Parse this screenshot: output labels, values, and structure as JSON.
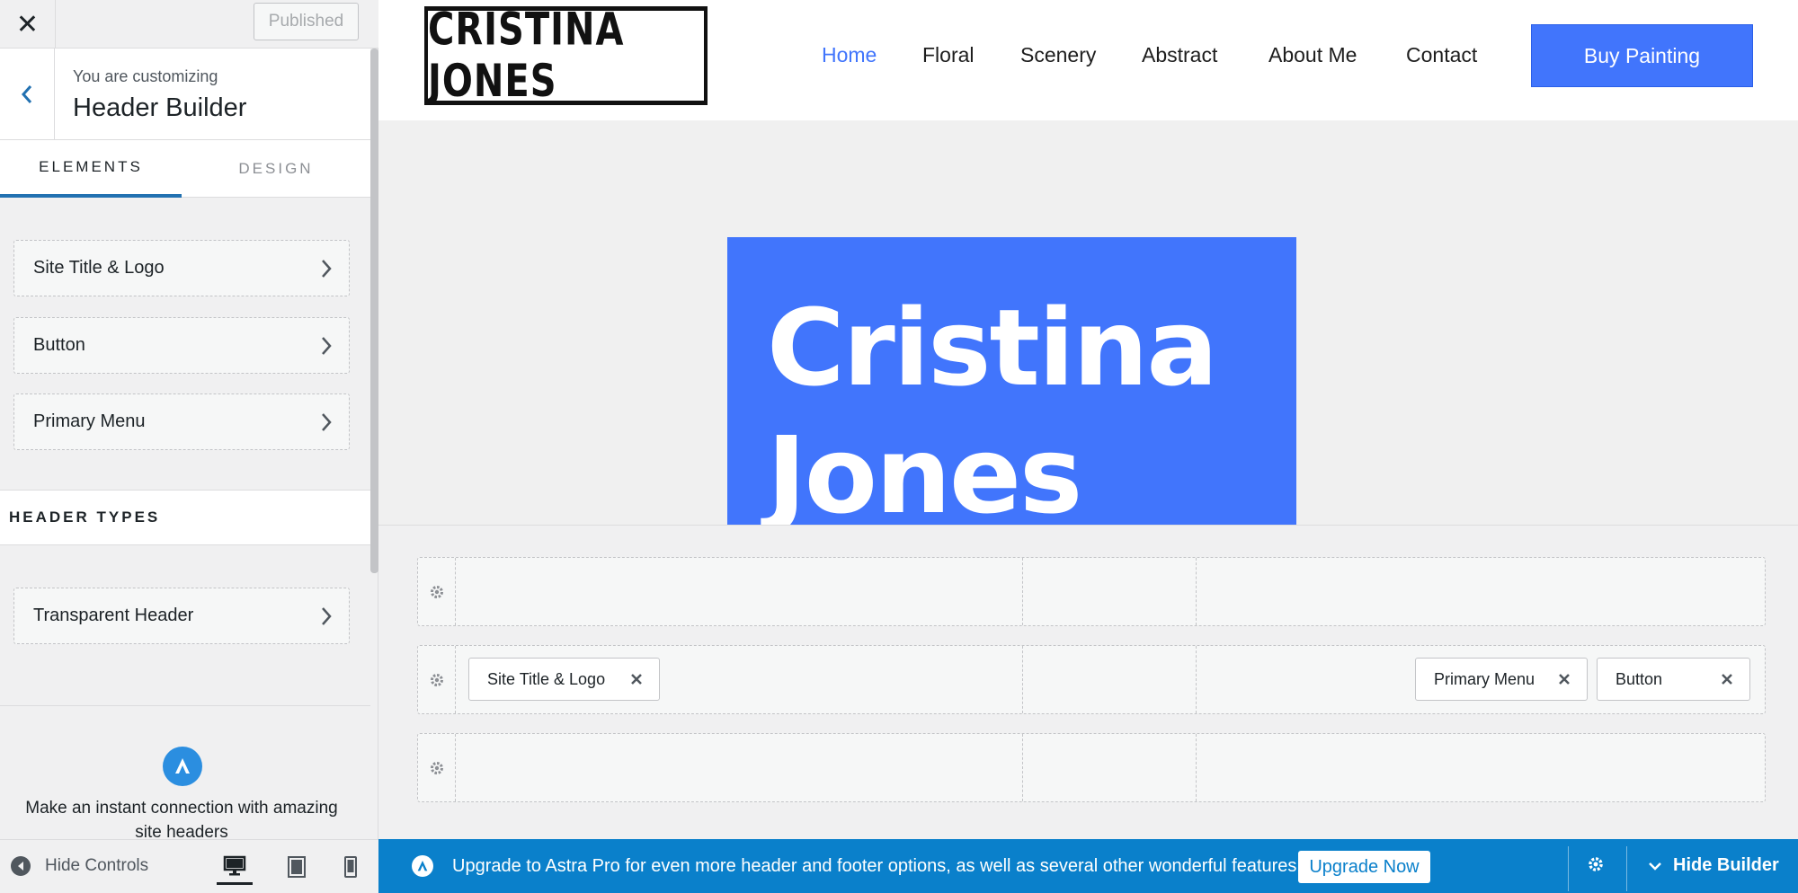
{
  "colors": {
    "accent": "#4175fc",
    "wp_blue": "#2271b1",
    "astra_bar": "#0a80cb"
  },
  "sidebar": {
    "close_icon": "close-icon",
    "published_label": "Published",
    "subtitle": "You are customizing",
    "title": "Header Builder",
    "tabs": [
      {
        "label": "ELEMENTS",
        "active": true
      },
      {
        "label": "DESIGN",
        "active": false
      }
    ],
    "elements": [
      {
        "label": "Site Title & Logo"
      },
      {
        "label": "Button"
      },
      {
        "label": "Primary Menu"
      }
    ],
    "header_types_heading": "HEADER TYPES",
    "header_types": [
      {
        "label": "Transparent Header"
      }
    ],
    "promo_text": "Make an instant connection with amazing site headers",
    "footer": {
      "hide_controls_label": "Hide Controls",
      "devices": [
        "desktop",
        "tablet",
        "mobile"
      ],
      "active_device": "desktop"
    }
  },
  "preview": {
    "logo_text": "CRISTINA JONES",
    "nav": [
      {
        "label": "Home",
        "current": true
      },
      {
        "label": "Floral",
        "current": false
      },
      {
        "label": "Scenery",
        "current": false
      },
      {
        "label": "Abstract",
        "current": false
      },
      {
        "label": "About Me",
        "current": false
      },
      {
        "label": "Contact",
        "current": false
      }
    ],
    "cta_label": "Buy Painting",
    "hero_title": "Cristina Jones"
  },
  "builder": {
    "rows": [
      {
        "name": "above-header",
        "chips": []
      },
      {
        "name": "primary-header",
        "chips": [
          {
            "label": "Site Title & Logo",
            "zone": "left"
          },
          {
            "label": "Primary Menu",
            "zone": "right"
          },
          {
            "label": "Button",
            "zone": "right"
          }
        ]
      },
      {
        "name": "below-header",
        "chips": []
      }
    ]
  },
  "bottom_bar": {
    "message": "Upgrade to Astra Pro for even more header and footer options, as well as several other wonderful features!",
    "upgrade_label": "Upgrade Now",
    "hide_builder_label": "Hide Builder"
  }
}
